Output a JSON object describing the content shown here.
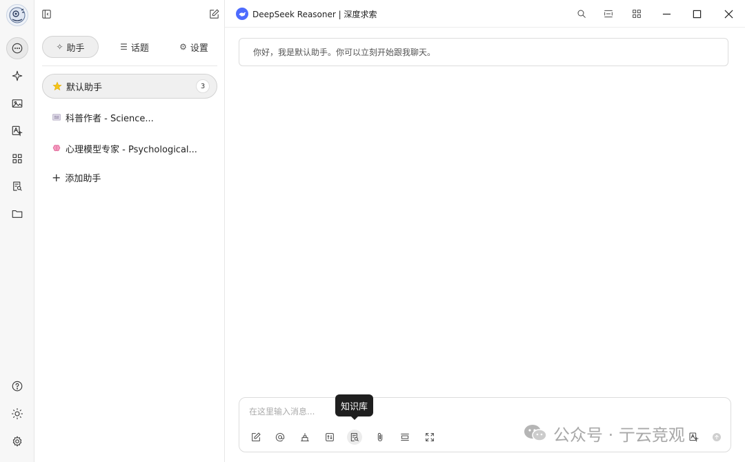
{
  "window": {
    "title": "DeepSeek Reasoner | 深度求索"
  },
  "rail": {
    "items": [
      {
        "name": "chat-icon",
        "active": true
      },
      {
        "name": "sparkle-icon"
      },
      {
        "name": "image-icon"
      },
      {
        "name": "translate-icon"
      },
      {
        "name": "apps-grid-icon"
      },
      {
        "name": "knowledge-base-icon"
      },
      {
        "name": "folder-icon"
      }
    ],
    "bottom": [
      "help-icon",
      "theme-sun-icon",
      "settings-gear-icon"
    ]
  },
  "tabs": {
    "assistants": "助手",
    "topics": "话题",
    "settings": "设置"
  },
  "assistants": [
    {
      "emoji": "star-icon",
      "label": "默认助手",
      "count": "3",
      "active": true
    },
    {
      "emoji": "newspaper-icon",
      "label": "科普作者 - Science..."
    },
    {
      "emoji": "brain-icon",
      "label": "心理模型专家 - Psychological..."
    }
  ],
  "add_assistant": "添加助手",
  "chat": {
    "welcome": "你好，我是默认助手。你可以立刻开始跟我聊天。"
  },
  "composer": {
    "placeholder": "在这里输入消息...",
    "tooltip": "知识库",
    "tools": [
      "new-topic-icon",
      "mention-icon",
      "clear-icon",
      "settings-sliders-icon",
      "knowledge-base-icon",
      "attachment-icon",
      "collapse-icon",
      "expand-icon",
      "translate-icon",
      "send-icon"
    ]
  },
  "watermark": {
    "text": "公众号 · 亍云竞观"
  },
  "colors": {
    "accent": "#4d6bfe",
    "star": "#f5c518",
    "brain": "#f06fa3"
  }
}
